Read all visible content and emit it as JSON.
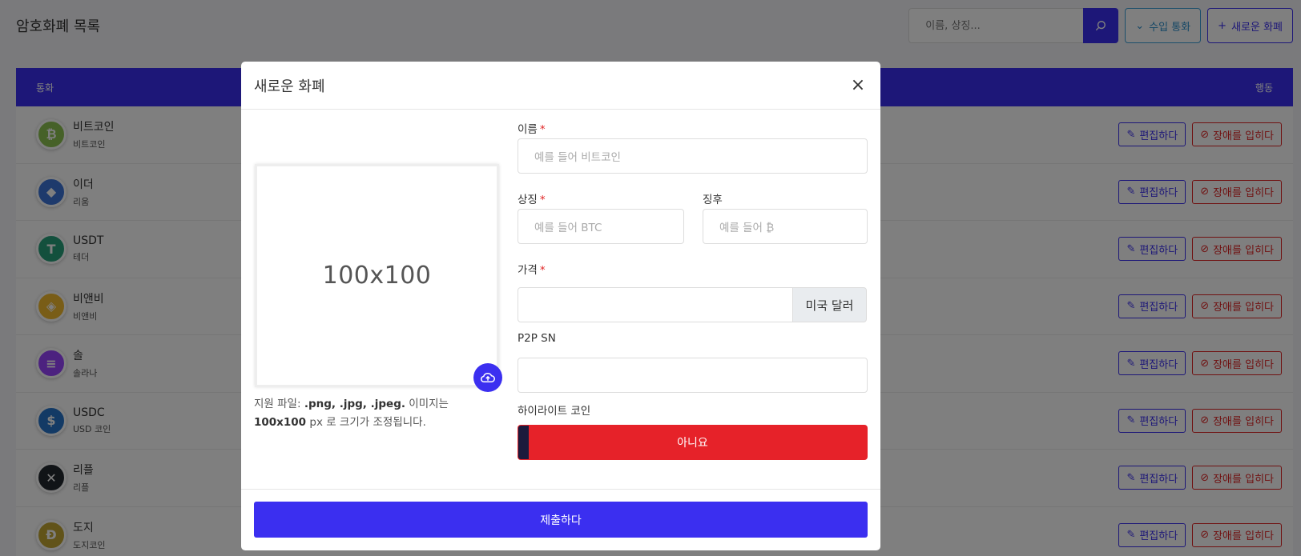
{
  "page": {
    "title": "암호화폐 목록",
    "search_placeholder": "이름, 상징...",
    "import_button": "수입 통화",
    "new_button": "새로운 화폐"
  },
  "table": {
    "col_currency": "통화",
    "col_actions": "행동",
    "edit_label": "편집하다",
    "disable_label": "장애를 입히다",
    "rows": [
      {
        "name": "비트코인",
        "sub": "비트코인",
        "color": "#8dc351",
        "glyph": "₿"
      },
      {
        "name": "이더",
        "sub": "리움",
        "color": "#3c74d9",
        "glyph": "◆"
      },
      {
        "name": "USDT",
        "sub": "테더",
        "color": "#26a17b",
        "glyph": "T"
      },
      {
        "name": "비앤비",
        "sub": "비앤비",
        "color": "#f3ba2f",
        "glyph": "◈"
      },
      {
        "name": "솔",
        "sub": "솔라나",
        "color": "#9945ff",
        "glyph": "≡"
      },
      {
        "name": "USDC",
        "sub": "USD 코인",
        "color": "#2775ca",
        "glyph": "$"
      },
      {
        "name": "리플",
        "sub": "리플",
        "color": "#23292f",
        "glyph": "✕"
      },
      {
        "name": "도지",
        "sub": "도지코인",
        "color": "#c2a633",
        "glyph": "Ð"
      }
    ]
  },
  "modal": {
    "title": "새로운 화폐",
    "image_placeholder": "100x100",
    "hint_prefix": "지원 파일: ",
    "hint_formats": ".png, .jpg, .jpeg.",
    "hint_middle": " 이미지는 ",
    "hint_size": "100x100",
    "hint_suffix": " px 로 크기가 조정됩니다.",
    "name_label": "이름",
    "name_placeholder": "예를 들어 비트코인",
    "symbol_label": "상징",
    "symbol_placeholder": "예를 들어 BTC",
    "sign_label": "징후",
    "sign_placeholder": "예를 들어 ₿",
    "price_label": "가격",
    "price_addon": "미국 달러",
    "p2p_label": "P2P SN",
    "highlight_label": "하이라이트 코인",
    "highlight_value": "아니요",
    "submit_label": "제출하다"
  }
}
